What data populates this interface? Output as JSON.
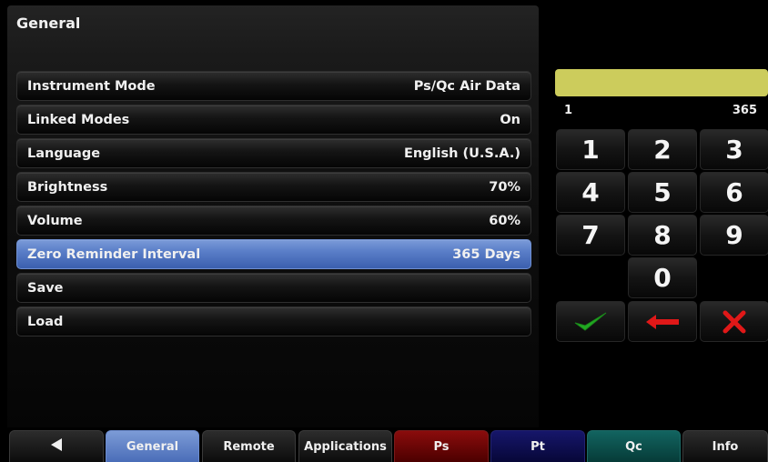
{
  "panel": {
    "title": "General",
    "settings": [
      {
        "label": "Instrument Mode",
        "value": "Ps/Qc Air Data",
        "selected": false
      },
      {
        "label": "Linked Modes",
        "value": "On",
        "selected": false
      },
      {
        "label": "Language",
        "value": "English (U.S.A.)",
        "selected": false
      },
      {
        "label": "Brightness",
        "value": "70%",
        "selected": false
      },
      {
        "label": "Volume",
        "value": "60%",
        "selected": false
      },
      {
        "label": "Zero Reminder Interval",
        "value": "365 Days",
        "selected": true
      },
      {
        "label": "Save",
        "value": "",
        "selected": false
      },
      {
        "label": "Load",
        "value": "",
        "selected": false
      }
    ]
  },
  "keypad": {
    "input_value": "",
    "range_min": "1",
    "range_max": "365",
    "digits": [
      "1",
      "2",
      "3",
      "4",
      "5",
      "6",
      "7",
      "8",
      "9",
      "0"
    ],
    "accept_icon": "checkmark-icon",
    "backspace_icon": "left-arrow-icon",
    "cancel_icon": "x-icon",
    "colors": {
      "display": "#cccc5c",
      "accept": "#22aa22",
      "backspace": "#e01818",
      "cancel": "#e01818"
    }
  },
  "tabs": {
    "back_icon": "back-triangle-icon",
    "items": [
      "General",
      "Remote",
      "Applications",
      "Ps",
      "Pt",
      "Qc",
      "Info"
    ],
    "active": "General",
    "colors": {
      "general": "#5a7ec8",
      "ps": "#6a0808",
      "pt": "#0d0d50",
      "qc": "#0b4f4c"
    }
  }
}
